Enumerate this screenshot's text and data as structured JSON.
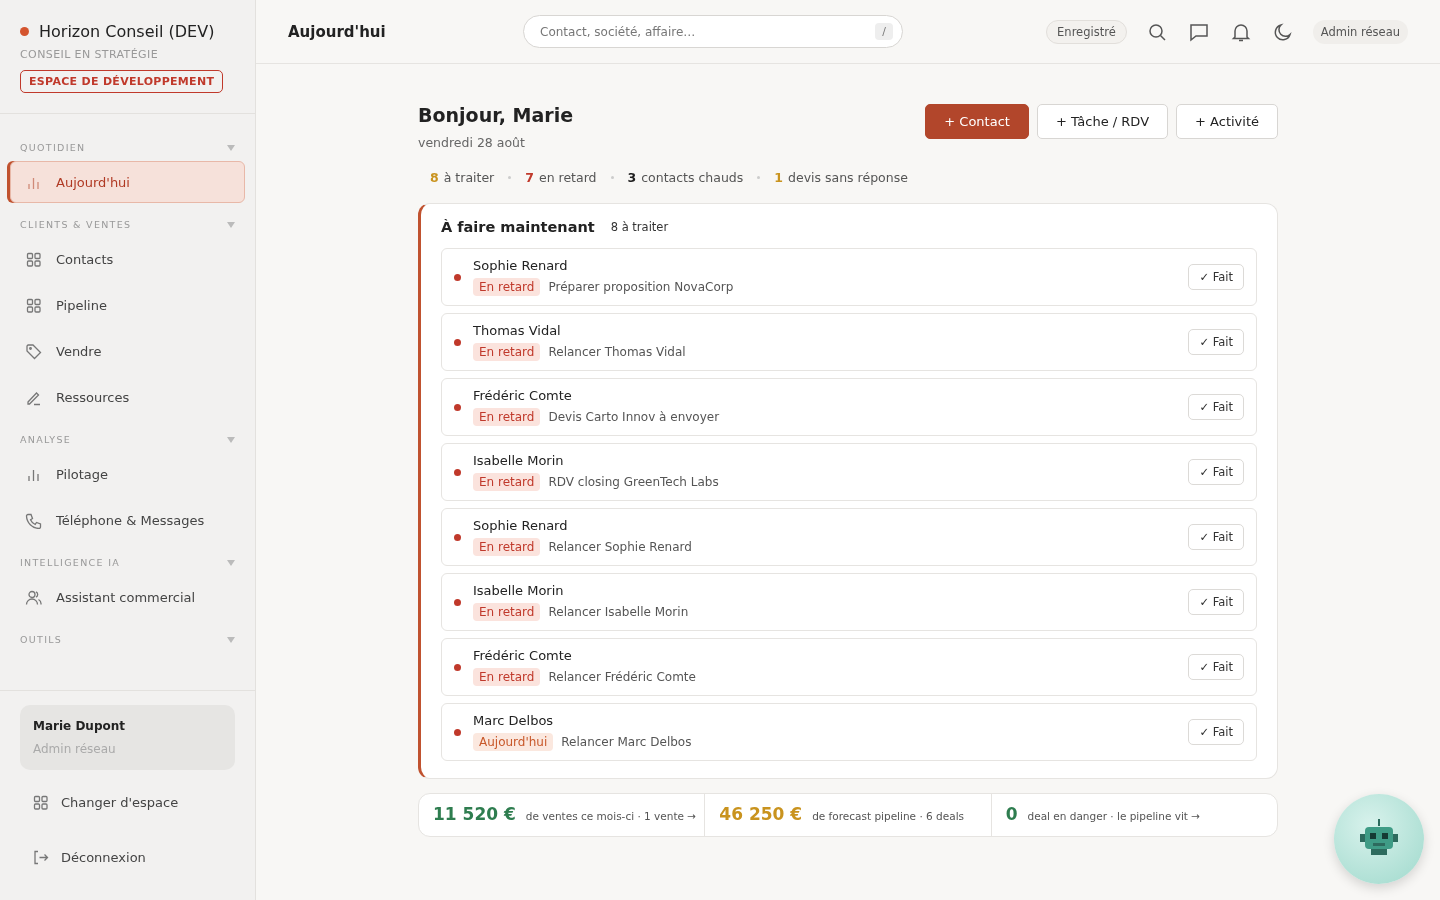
{
  "brand": {
    "name": "Horizon Conseil (DEV)",
    "subtitle": "CONSEIL EN STRATÉGIE",
    "env_badge": "ESPACE DE DÉVELOPPEMENT"
  },
  "sidebar": {
    "sections": [
      {
        "title": "QUOTIDIEN",
        "items": [
          {
            "label": "Aujourd'hui",
            "selected": true
          }
        ]
      },
      {
        "title": "CLIENTS & VENTES",
        "items": [
          {
            "label": "Contacts",
            "selected": false
          },
          {
            "label": "Pipeline",
            "selected": false
          },
          {
            "label": "Vendre",
            "selected": false
          },
          {
            "label": "Ressources",
            "selected": false
          }
        ]
      },
      {
        "title": "ANALYSE",
        "items": [
          {
            "label": "Pilotage",
            "selected": false
          },
          {
            "label": "Téléphone & Messages",
            "selected": false
          }
        ]
      },
      {
        "title": "INTELLIGENCE IA",
        "items": [
          {
            "label": "Assistant commercial",
            "selected": false
          }
        ]
      },
      {
        "title": "OUTILS"
      }
    ],
    "user": {
      "name": "Marie Dupont",
      "role": "Admin réseau"
    },
    "footer_items": [
      {
        "label": "Changer d'espace"
      },
      {
        "label": "Déconnexion"
      }
    ]
  },
  "header": {
    "title": "Aujourd'hui",
    "search": {
      "placeholder": "Contact, société, affaire…",
      "shortcut": "/"
    },
    "saved_badge": "Enregistré",
    "user_button": "Admin réseau"
  },
  "greeting": {
    "title": "Bonjour, Marie",
    "date": "vendredi 28 août"
  },
  "actions": [
    {
      "label": "+ Contact",
      "primary": true
    },
    {
      "label": "+ Tâche / RDV",
      "primary": false
    },
    {
      "label": "+ Activité",
      "primary": false
    }
  ],
  "summary": [
    {
      "count": "8",
      "label": "à traiter",
      "color": "#c9931e"
    },
    {
      "count": "7",
      "label": "en retard",
      "color": "#c0392b"
    },
    {
      "count": "3",
      "label": "contacts chauds",
      "color": "#1f1f1f"
    },
    {
      "count": "1",
      "label": "devis sans réponse",
      "color": "#c9931e"
    }
  ],
  "todo": {
    "title": "À faire maintenant",
    "count": "8 à traiter",
    "tasks": [
      {
        "contact": "Sophie Renard",
        "tag": "En retard",
        "kind": "late",
        "text": "Préparer proposition NovaCorp",
        "button": "✓ Fait",
        "color": "#c0392b"
      },
      {
        "contact": "Thomas Vidal",
        "tag": "En retard",
        "kind": "late",
        "text": "Relancer Thomas Vidal",
        "button": "✓ Fait",
        "color": "#c0392b"
      },
      {
        "contact": "Frédéric Comte",
        "tag": "En retard",
        "kind": "late",
        "text": "Devis Carto Innov à envoyer",
        "button": "✓ Fait",
        "color": "#c0392b"
      },
      {
        "contact": "Isabelle Morin",
        "tag": "En retard",
        "kind": "late",
        "text": "RDV closing GreenTech Labs",
        "button": "✓ Fait",
        "color": "#c0392b"
      },
      {
        "contact": "Sophie Renard",
        "tag": "En retard",
        "kind": "late",
        "text": "Relancer Sophie Renard",
        "button": "✓ Fait",
        "color": "#c0392b"
      },
      {
        "contact": "Isabelle Morin",
        "tag": "En retard",
        "kind": "late",
        "text": "Relancer Isabelle Morin",
        "button": "✓ Fait",
        "color": "#c0392b"
      },
      {
        "contact": "Frédéric Comte",
        "tag": "En retard",
        "kind": "late",
        "text": "Relancer Frédéric Comte",
        "button": "✓ Fait",
        "color": "#c0392b"
      },
      {
        "contact": "Marc Delbos",
        "tag": "Aujourd'hui",
        "kind": "today",
        "text": "Relancer Marc Delbos",
        "button": "✓ Fait",
        "color": "#c0392b"
      }
    ]
  },
  "stats": [
    {
      "value": "11 520 €",
      "label": "de ventes ce mois-ci · 1 vente →",
      "color": "#2e7d4f"
    },
    {
      "value": "46 250 €",
      "label": "de forecast pipeline · 6 deals",
      "color": "#c9931e"
    },
    {
      "value": "0",
      "label": "deal en danger · le pipeline vit →",
      "color": "#2e7d4f"
    }
  ]
}
